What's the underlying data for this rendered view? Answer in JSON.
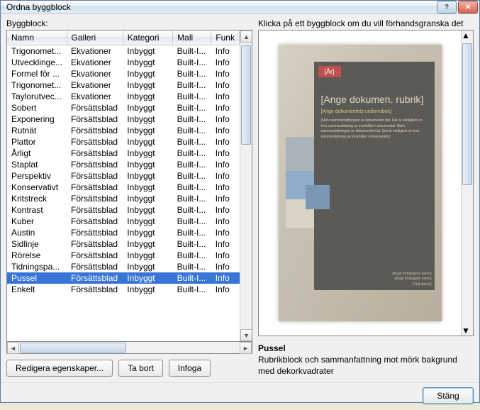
{
  "window": {
    "title": "Ordna byggblock"
  },
  "left": {
    "label": "Byggblock:",
    "columns": [
      "Namn",
      "Galleri",
      "Kategori",
      "Mall",
      "Funk"
    ],
    "rows": [
      {
        "name": "Trigonomet...",
        "galleri": "Ekvationer",
        "kategori": "Inbyggt",
        "mall": "Built-I...",
        "funk": "Info"
      },
      {
        "name": "Utvecklinge...",
        "galleri": "Ekvationer",
        "kategori": "Inbyggt",
        "mall": "Built-I...",
        "funk": "Info"
      },
      {
        "name": "Formel för ...",
        "galleri": "Ekvationer",
        "kategori": "Inbyggt",
        "mall": "Built-I...",
        "funk": "Info"
      },
      {
        "name": "Trigonomet...",
        "galleri": "Ekvationer",
        "kategori": "Inbyggt",
        "mall": "Built-I...",
        "funk": "Info"
      },
      {
        "name": "Taylorutvec...",
        "galleri": "Ekvationer",
        "kategori": "Inbyggt",
        "mall": "Built-I...",
        "funk": "Info"
      },
      {
        "name": "Sobert",
        "galleri": "Försättsblad",
        "kategori": "Inbyggt",
        "mall": "Built-I...",
        "funk": "Info"
      },
      {
        "name": "Exponering",
        "galleri": "Försättsblad",
        "kategori": "Inbyggt",
        "mall": "Built-I...",
        "funk": "Info"
      },
      {
        "name": "Rutnät",
        "galleri": "Försättsblad",
        "kategori": "Inbyggt",
        "mall": "Built-I...",
        "funk": "Info"
      },
      {
        "name": "Plattor",
        "galleri": "Försättsblad",
        "kategori": "Inbyggt",
        "mall": "Built-I...",
        "funk": "Info"
      },
      {
        "name": "Årligt",
        "galleri": "Försättsblad",
        "kategori": "Inbyggt",
        "mall": "Built-I...",
        "funk": "Info"
      },
      {
        "name": "Staplat",
        "galleri": "Försättsblad",
        "kategori": "Inbyggt",
        "mall": "Built-I...",
        "funk": "Info"
      },
      {
        "name": "Perspektiv",
        "galleri": "Försättsblad",
        "kategori": "Inbyggt",
        "mall": "Built-I...",
        "funk": "Info"
      },
      {
        "name": "Konservativt",
        "galleri": "Försättsblad",
        "kategori": "Inbyggt",
        "mall": "Built-I...",
        "funk": "Info"
      },
      {
        "name": "Kritstreck",
        "galleri": "Försättsblad",
        "kategori": "Inbyggt",
        "mall": "Built-I...",
        "funk": "Info"
      },
      {
        "name": "Kontrast",
        "galleri": "Försättsblad",
        "kategori": "Inbyggt",
        "mall": "Built-I...",
        "funk": "Info"
      },
      {
        "name": "Kuber",
        "galleri": "Försättsblad",
        "kategori": "Inbyggt",
        "mall": "Built-I...",
        "funk": "Info"
      },
      {
        "name": "Austin",
        "galleri": "Försättsblad",
        "kategori": "Inbyggt",
        "mall": "Built-I...",
        "funk": "Info"
      },
      {
        "name": "Sidlinje",
        "galleri": "Försättsblad",
        "kategori": "Inbyggt",
        "mall": "Built-I...",
        "funk": "Info"
      },
      {
        "name": "Rörelse",
        "galleri": "Försättsblad",
        "kategori": "Inbyggt",
        "mall": "Built-I...",
        "funk": "Info"
      },
      {
        "name": "Tidningspa...",
        "galleri": "Försättsblad",
        "kategori": "Inbyggt",
        "mall": "Built-I...",
        "funk": "Info"
      },
      {
        "name": "Pussel",
        "galleri": "Försättsblad",
        "kategori": "Inbyggt",
        "mall": "Built-I...",
        "funk": "Info",
        "selected": true
      },
      {
        "name": "Enkelt",
        "galleri": "Försättsblad",
        "kategori": "Inbyggt",
        "mall": "Built-I...",
        "funk": "Info"
      }
    ],
    "buttons": {
      "edit": "Redigera egenskaper...",
      "delete": "Ta bort",
      "insert": "Infoga"
    }
  },
  "right": {
    "label": "Klicka på ett byggblock om du vill förhandsgranska det",
    "preview": {
      "year": "[År]",
      "title": "[Ange dokumen. rubrik]",
      "subtitle": "[Ange dokumentets underrubrik]",
      "body": "[Skriv sammanfattningen av dokumentet här. Det är vanligtvis en kort sammanfattning av innehållet i dokumentet. Skriv sammanfattningen av dokumentet här. Det är vanligtvis en kort sammanfattning av innehållet i dokumentet.]",
      "footer1": "[Ange författarens namn]",
      "footer2": "[Ange företagets namn]",
      "footer3": "[Välj datum]"
    },
    "title": "Pussel",
    "description": "Rubrikblock och sammanfattning mot mörk bakgrund med dekorkvadrater"
  },
  "footer": {
    "close": "Stäng"
  }
}
